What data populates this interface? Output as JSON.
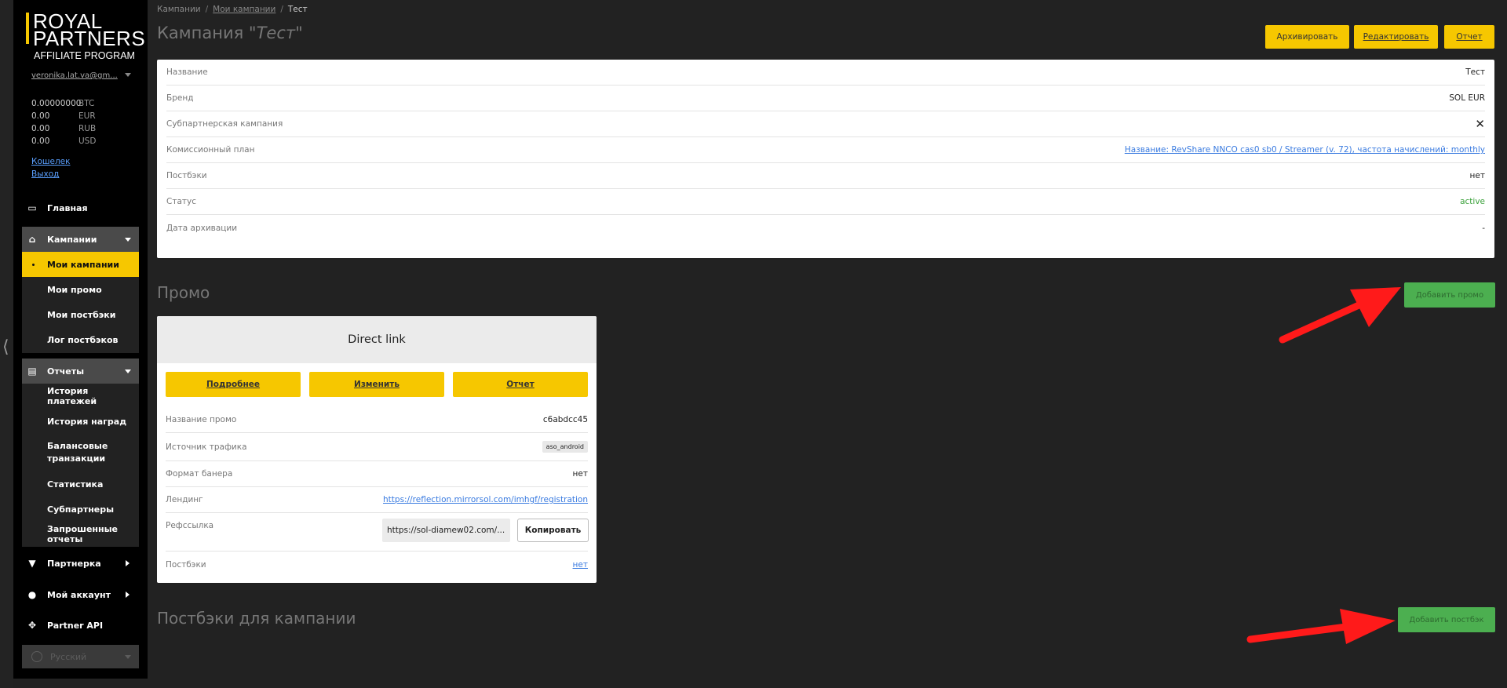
{
  "logo": {
    "line1": "ROYAL",
    "line2": "PARTNERS",
    "line3": "AFFILIATE PROGRAM",
    "accent_color": "#f6c700"
  },
  "account": {
    "email": "veronika.lat.va@gm...",
    "balances": [
      {
        "amount": "0.00000000",
        "currency": "BTC"
      },
      {
        "amount": "0.00",
        "currency": "EUR"
      },
      {
        "amount": "0.00",
        "currency": "RUB"
      },
      {
        "amount": "0.00",
        "currency": "USD"
      }
    ],
    "wallet_link": "Кошелек",
    "logout_link": "Выход"
  },
  "nav": {
    "home": "Главная",
    "campaigns": {
      "label": "Кампании",
      "items": [
        "Мои кампании",
        "Мои промо",
        "Мои постбэки",
        "Лог постбэков"
      ],
      "active_index": 0
    },
    "reports": {
      "label": "Отчеты",
      "items": [
        "История платежей",
        "История наград",
        "Балансовые транзакции",
        "Статистика",
        "Субпартнеры",
        "Запрошенные отчеты"
      ]
    },
    "partnerka": "Партнерка",
    "my_account": "Мой аккаунт",
    "partner_api": "Partner API",
    "language": "Русский"
  },
  "breadcrumb": {
    "items": [
      "Кампании",
      "Мои кампании",
      "Тест"
    ]
  },
  "page": {
    "title_prefix": "Кампания",
    "title_name": "\"Тест\"",
    "buttons": {
      "archive": "Архивировать",
      "edit": "Редактировать",
      "report": "Отчет"
    }
  },
  "campaign_details": [
    {
      "key": "Название",
      "value": "Тест",
      "style": "plain"
    },
    {
      "key": "Бренд",
      "value": "SOL EUR",
      "style": "plain"
    },
    {
      "key": "Субпартнерская кампания",
      "value": "✕",
      "style": "plain"
    },
    {
      "key": "Комиссионный план",
      "value": "Название: RevShare NNCO cas0 sb0 / Streamer (v. 72), частота начислений: monthly",
      "style": "link"
    },
    {
      "key": "Постбэки",
      "value": "нет",
      "style": "plain"
    },
    {
      "key": "Статус",
      "value": "active",
      "style": "green"
    },
    {
      "key": "Дата архивации",
      "value": "-",
      "style": "plain"
    }
  ],
  "promo_section": {
    "title": "Промо",
    "add_button": "Добавить промо",
    "card": {
      "title": "Direct link",
      "buttons": {
        "details": "Подробнее",
        "change": "Изменить",
        "report": "Отчет"
      },
      "rows": {
        "name_label": "Название промо",
        "name_value": "c6abdcc45",
        "source_label": "Источник трафика",
        "source_value": "aso_android",
        "banner_label": "Формат банера",
        "banner_value": "нет",
        "landing_label": "Лендинг",
        "landing_value": "https://reflection.mirrorsol.com/imhgf/registration",
        "ref_label": "Рефссылка",
        "ref_value": "https://sol-diamew02.com/...",
        "copy_button": "Копировать",
        "postback_label": "Постбэки",
        "postback_value": "нет"
      }
    }
  },
  "postback_section": {
    "title": "Постбэки для кампании",
    "add_button": "Добавить постбэк"
  },
  "colors": {
    "yellow": "#f6c700",
    "green_button": "#4caf50",
    "status_active": "#3aa13a",
    "link": "#3a7be0",
    "annotation_arrow": "#ff1a1a"
  }
}
